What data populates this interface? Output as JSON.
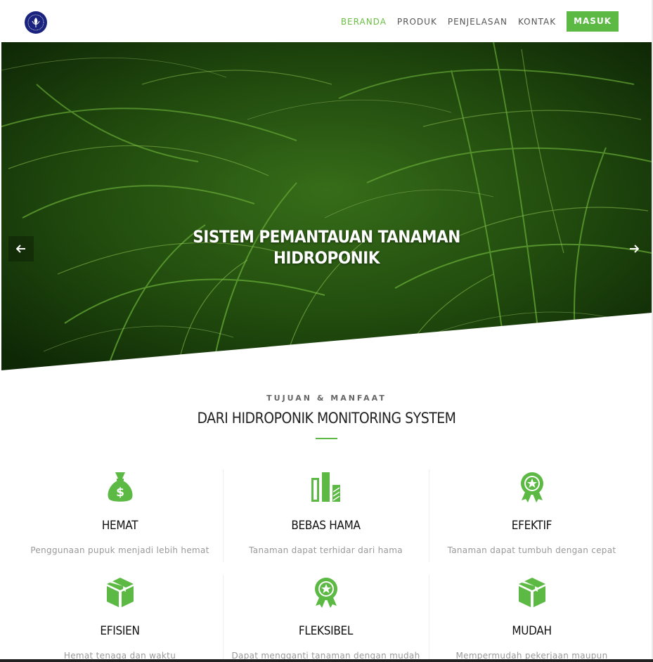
{
  "nav": {
    "items": [
      {
        "label": "BERANDA",
        "active": true
      },
      {
        "label": "PRODUK",
        "active": false
      },
      {
        "label": "PENJELASAN",
        "active": false
      },
      {
        "label": "KONTAK",
        "active": false
      }
    ],
    "login_label": "MASUK"
  },
  "hero": {
    "title_line1": "SISTEM PEMANTAUAN TANAMAN",
    "title_line2": "HIDROPONIK",
    "prev_icon": "arrow-left-icon",
    "next_icon": "arrow-right-icon"
  },
  "section": {
    "subtitle": "TUJUAN & MANFAAT",
    "title": "DARI HIDROPONIK MONITORING SYSTEM"
  },
  "features": [
    {
      "icon": "money-bag-icon",
      "title": "HEMAT",
      "text": "Penggunaan pupuk menjadi lebih hemat"
    },
    {
      "icon": "bar-chart-icon",
      "title": "BEBAS HAMA",
      "text": "Tanaman dapat terhidar dari hama"
    },
    {
      "icon": "award-ribbon-icon",
      "title": "EFEKTIF",
      "text": "Tanaman dapat tumbuh dengan cepat"
    },
    {
      "icon": "box-icon",
      "title": "EFISIEN",
      "text": "Hemat tenaga dan waktu"
    },
    {
      "icon": "award-ribbon-icon",
      "title": "FLEKSIBEL",
      "text": "Dapat mengganti tanaman dengan mudah"
    },
    {
      "icon": "box-icon",
      "title": "MUDAH",
      "text": "Mempermudah pekerjaan maupun"
    }
  ],
  "colors": {
    "accent": "#5cb944",
    "logo": "#1a237e"
  }
}
